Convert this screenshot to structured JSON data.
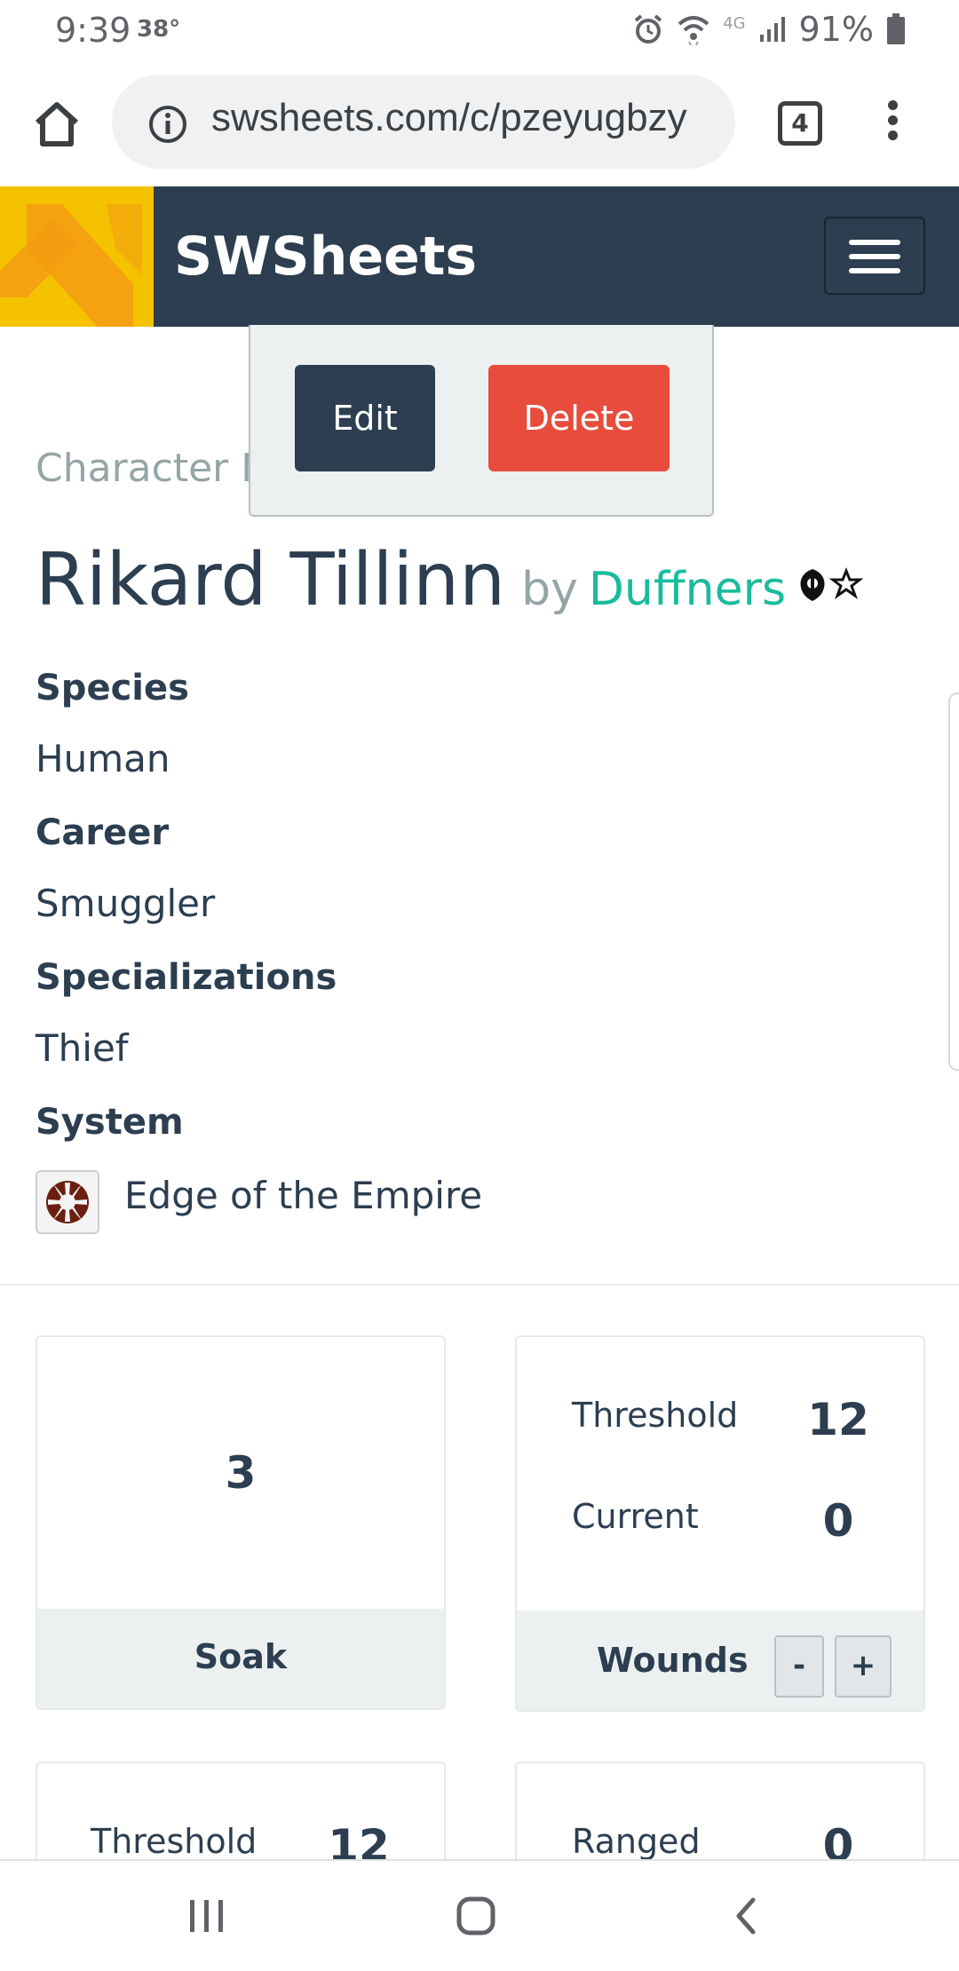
{
  "status_bar": {
    "time": "9:39",
    "temperature": "38°",
    "network": "4G",
    "battery_percent": "91%",
    "icons": [
      "alarm-icon",
      "wifi-icon",
      "signal-icon",
      "battery-icon"
    ]
  },
  "browser": {
    "url": "swsheets.com/c/pzeyugbzy",
    "tab_count": "4",
    "icons": [
      "home-icon",
      "info-icon",
      "more-vert-icon"
    ]
  },
  "navbar": {
    "brand": "SWSheets",
    "logo_color": "#f5c200",
    "background_color": "#2c3e50"
  },
  "dropdown": {
    "edit_label": "Edit",
    "delete_label": "Delete",
    "edit_color": "#2c3e50",
    "delete_color": "#e74c3c"
  },
  "character": {
    "name_label": "Character N",
    "name": "Rikard Tillinn",
    "by_label": "by",
    "author": "Duffners",
    "author_icons": [
      "rebel-icon",
      "star-icon"
    ],
    "fields": [
      {
        "label": "Species",
        "value": "Human"
      },
      {
        "label": "Career",
        "value": "Smuggler"
      },
      {
        "label": "Specializations",
        "value": "Thief"
      },
      {
        "label": "System",
        "value": "Edge of the Empire"
      }
    ],
    "system_icon": "empire-icon"
  },
  "stats": {
    "soak": {
      "value": "3",
      "label": "Soak"
    },
    "wounds": {
      "label": "Wounds",
      "threshold_label": "Threshold",
      "threshold_value": "12",
      "current_label": "Current",
      "current_value": "0",
      "decrement_label": "-",
      "increment_label": "+"
    },
    "strain": {
      "threshold_label": "Threshold",
      "threshold_value": "12"
    },
    "defense": {
      "ranged_label": "Ranged",
      "ranged_value": "0"
    }
  },
  "system_nav": {
    "icons": [
      "recent-apps-icon",
      "home-circle-icon",
      "back-icon"
    ]
  }
}
